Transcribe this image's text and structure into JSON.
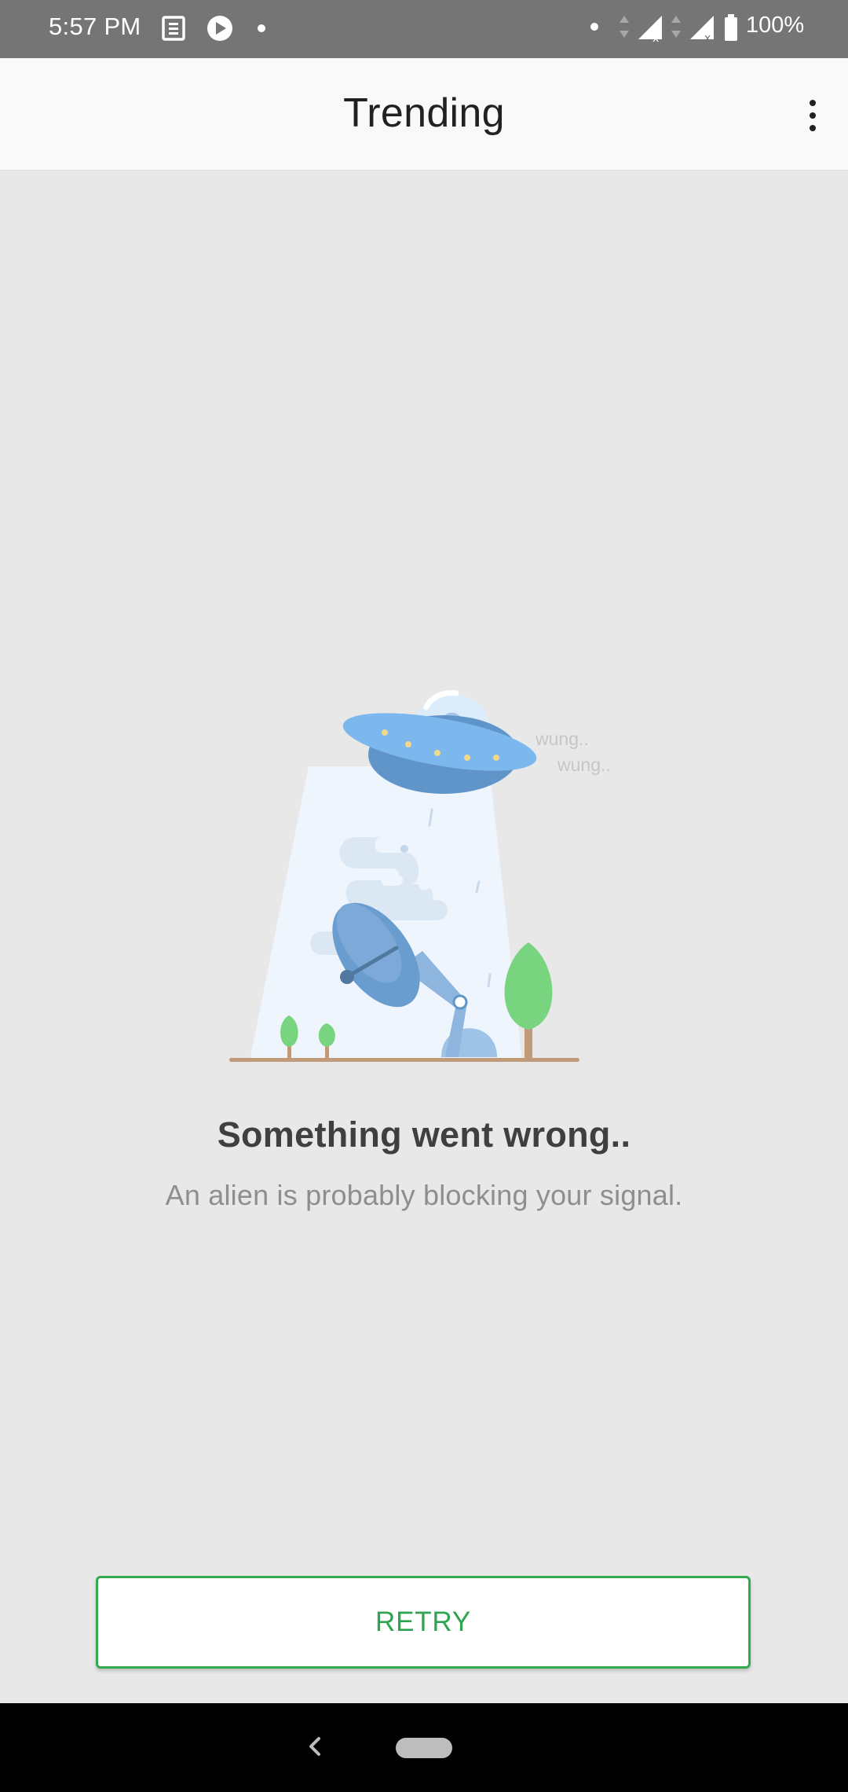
{
  "status_bar": {
    "time": "5:57 PM",
    "battery": "100%",
    "icons": [
      "news-icon",
      "play-icon",
      "dot-icon",
      "dot-icon",
      "data-arrows-icon",
      "signal-icon",
      "signal-icon",
      "battery-icon"
    ]
  },
  "app_bar": {
    "title": "Trending",
    "menu_icon": "more-vert-icon"
  },
  "illustration": {
    "caption_1": "wung..",
    "caption_2": "wung.."
  },
  "error": {
    "title": "Something went wrong..",
    "message": "An alien is probably blocking your signal."
  },
  "retry_button": {
    "label": "RETRY"
  },
  "colors": {
    "accent": "#35a852",
    "status_bar": "#757575",
    "background": "#e8e8e8"
  },
  "nav_bar": {
    "icons": [
      "back-icon",
      "home-pill-icon"
    ]
  }
}
